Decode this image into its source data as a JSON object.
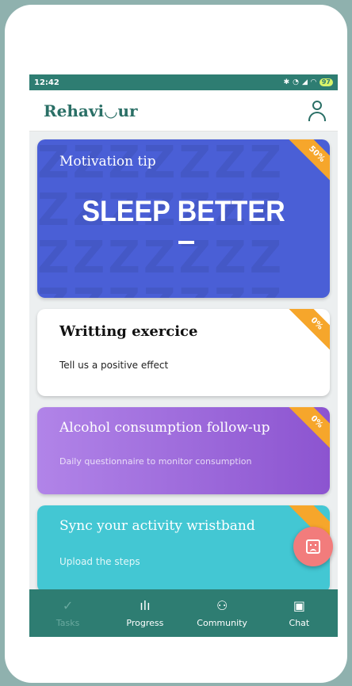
{
  "status_bar": {
    "time": "12:42",
    "icons": [
      "bluetooth-icon",
      "alarm-icon",
      "sim-icon",
      "signal-icon",
      "wifi-icon"
    ],
    "battery": "97"
  },
  "app_bar": {
    "logo": "Rehavi◡ur",
    "profile_icon": "person-icon"
  },
  "cards": [
    {
      "title": "Motivation tip",
      "headline": "SLEEP BETTER",
      "badge": "50%",
      "color": "#4a5fd6",
      "badge_color": "#f6a62b"
    },
    {
      "title": "Writting exercice",
      "subtitle": "Tell us a positive effect",
      "badge": "0%",
      "badge_color": "#f6a62b"
    },
    {
      "title": "Alcohol consumption follow-up",
      "subtitle": "Daily questionnaire to monitor consumption",
      "badge": "0%",
      "badge_color": "#f6a62b"
    },
    {
      "title": "Sync your activity wristband",
      "subtitle": "Upload the steps",
      "badge_color": "#f6a62b"
    }
  ],
  "fab": {
    "icon": "sad-face-icon",
    "color": "#f27c7c"
  },
  "bottom_nav": {
    "items": [
      {
        "label": "Tasks",
        "icon": "check-icon",
        "active": true
      },
      {
        "label": "Progress",
        "icon": "bar-chart-icon",
        "active": false
      },
      {
        "label": "Community",
        "icon": "people-icon",
        "active": false
      },
      {
        "label": "Chat",
        "icon": "chat-icon",
        "active": false
      }
    ],
    "color": "#2e7d72"
  }
}
